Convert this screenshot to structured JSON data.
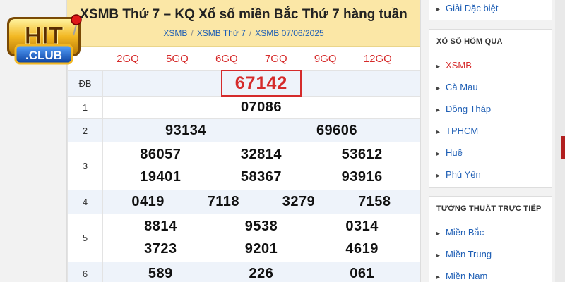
{
  "logo": {
    "text": "HIT",
    "subtext": ".CLUB"
  },
  "main": {
    "title": "XSMB Thứ 7 – KQ Xổ số miền Bắc Thứ 7 hàng tuần",
    "breadcrumb": [
      "XSMB",
      "XSMB Thứ 7",
      "XSMB 07/06/2025"
    ],
    "tabs": [
      "2GQ",
      "5GQ",
      "6GQ",
      "7GQ",
      "9GQ",
      "12GQ"
    ],
    "prizes": [
      {
        "label": "ĐB",
        "lines": [
          [
            "67142"
          ]
        ]
      },
      {
        "label": "1",
        "lines": [
          [
            "07086"
          ]
        ]
      },
      {
        "label": "2",
        "lines": [
          [
            "93134",
            "69606"
          ]
        ]
      },
      {
        "label": "3",
        "lines": [
          [
            "86057",
            "32814",
            "53612"
          ],
          [
            "19401",
            "58367",
            "93916"
          ]
        ]
      },
      {
        "label": "4",
        "lines": [
          [
            "0419",
            "7118",
            "3279",
            "7158"
          ]
        ]
      },
      {
        "label": "5",
        "lines": [
          [
            "8814",
            "9538",
            "0314"
          ],
          [
            "3723",
            "9201",
            "4619"
          ]
        ]
      },
      {
        "label": "6",
        "lines": [
          [
            "589",
            "226",
            "061"
          ]
        ]
      }
    ]
  },
  "sidebar": {
    "top_item": "Giải Đặc biệt",
    "yesterday": {
      "heading": "XỔ SỐ HÔM QUA",
      "items": [
        "XSMB",
        "Cà Mau",
        "Đồng Tháp",
        "TPHCM",
        "Huế",
        "Phú Yên"
      ]
    },
    "live": {
      "heading": "TƯỜNG THUẬT TRỰC TIẾP",
      "items": [
        "Miền Bắc",
        "Miền Trung",
        "Miền Nam"
      ]
    }
  },
  "colors": {
    "accent_red": "#d62b2b",
    "link_blue": "#1f5fb5",
    "title_bg": "#fbe7a6",
    "alt_row": "#eef3fa"
  }
}
